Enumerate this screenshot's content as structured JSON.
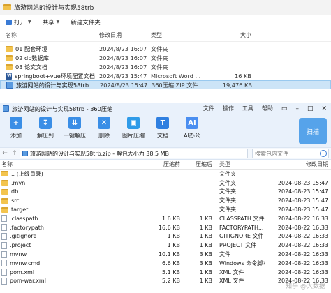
{
  "explorer": {
    "title": "旅游网站的设计与实现58trb",
    "toolbar": {
      "open": "打开",
      "share": "共享",
      "new_folder": "新建文件夹"
    },
    "header": {
      "name": "名称",
      "date": "修改日期",
      "type": "类型",
      "size": "大小"
    },
    "files": [
      {
        "name": "01 配套环境",
        "date": "2024/8/23 16:07",
        "type": "文件夹",
        "size": "",
        "icon": "folder-icon",
        "selected": false
      },
      {
        "name": "02 db数据库",
        "date": "2024/8/23 16:07",
        "type": "文件夹",
        "size": "",
        "icon": "folder-icon",
        "selected": false
      },
      {
        "name": "03 论文文档",
        "date": "2024/8/23 16:07",
        "type": "文件夹",
        "size": "",
        "icon": "folder-icon",
        "selected": false
      },
      {
        "name": "springboot+vue环境配置文档",
        "date": "2024/8/23 15:47",
        "type": "Microsoft Word ...",
        "size": "16 KB",
        "icon": "word-icon",
        "selected": false
      },
      {
        "name": "旅游网站的设计与实现58trb",
        "date": "2024/8/23 15:47",
        "type": "360压缩 ZIP 文件",
        "size": "19,476 KB",
        "icon": "zip-icon",
        "selected": true
      }
    ]
  },
  "zip_window": {
    "title": "旅游网站的设计与实现58trb - 360压缩",
    "menu": [
      "文件",
      "操作",
      "工具",
      "帮助"
    ],
    "toolbar": [
      {
        "label": "添加",
        "icon": "add-icon",
        "color": "#3a8ee6",
        "glyph": "+"
      },
      {
        "label": "解压到",
        "icon": "extract-to-icon",
        "color": "#3a8ee6",
        "glyph": "↧"
      },
      {
        "label": "一键解压",
        "icon": "one-click-extract-icon",
        "color": "#3a8ee6",
        "glyph": "⇊"
      },
      {
        "label": "删除",
        "icon": "delete-icon",
        "color": "#3a8ee6",
        "glyph": "✕"
      },
      {
        "label": "图片压缩",
        "icon": "image-compress-icon",
        "color": "#2f9be8",
        "glyph": "▣"
      },
      {
        "label": "文档",
        "icon": "document-icon",
        "color": "#2f7fe0",
        "glyph": "T"
      },
      {
        "label": "AI办公",
        "icon": "ai-office-icon",
        "color": "#4a8ef0",
        "glyph": "AI"
      }
    ],
    "scan_label": "扫描",
    "path": "旅游网站的设计与实现58trb.zip - 解包大小为 38.5 MB",
    "search_placeholder": "搜索包内文件",
    "header": {
      "name": "名称",
      "compressed": "压缩前",
      "original": "压缩后",
      "type": "类型",
      "date": "修改日期"
    },
    "rows": [
      {
        "name": ".. (上级目录)",
        "compressed": "",
        "original": "",
        "type": "文件夹",
        "date": "",
        "icon": "up-folder-icon"
      },
      {
        "name": ".mvn",
        "compressed": "",
        "original": "",
        "type": "文件夹",
        "date": "2024-08-23 15:47",
        "icon": "folder-icon"
      },
      {
        "name": "db",
        "compressed": "",
        "original": "",
        "type": "文件夹",
        "date": "2024-08-23 15:47",
        "icon": "folder-icon"
      },
      {
        "name": "src",
        "compressed": "",
        "original": "",
        "type": "文件夹",
        "date": "2024-08-23 15:47",
        "icon": "folder-icon"
      },
      {
        "name": "target",
        "compressed": "",
        "original": "",
        "type": "文件夹",
        "date": "2024-08-23 15:47",
        "icon": "folder-icon"
      },
      {
        "name": ".classpath",
        "compressed": "1.6 KB",
        "original": "1 KB",
        "type": "CLASSPATH 文件",
        "date": "2024-08-22 16:33",
        "icon": "file-icon"
      },
      {
        "name": ".factorypath",
        "compressed": "16.6 KB",
        "original": "1 KB",
        "type": "FACTORYPATH...",
        "date": "2024-08-22 16:33",
        "icon": "file-icon"
      },
      {
        "name": ".gitignore",
        "compressed": "1 KB",
        "original": "1 KB",
        "type": "GITIGNORE 文件",
        "date": "2024-08-22 16:33",
        "icon": "file-icon"
      },
      {
        "name": ".project",
        "compressed": "1 KB",
        "original": "1 KB",
        "type": "PROJECT 文件",
        "date": "2024-08-22 16:33",
        "icon": "file-icon"
      },
      {
        "name": "mvnw",
        "compressed": "10.1 KB",
        "original": "3 KB",
        "type": "文件",
        "date": "2024-08-22 16:33",
        "icon": "file-icon"
      },
      {
        "name": "mvnw.cmd",
        "compressed": "6.6 KB",
        "original": "3 KB",
        "type": "Windows 命令脚本",
        "date": "2024-08-22 16:33",
        "icon": "file-icon"
      },
      {
        "name": "pom.xml",
        "compressed": "5.1 KB",
        "original": "1 KB",
        "type": "XML 文件",
        "date": "2024-08-22 16:33",
        "icon": "file-icon"
      },
      {
        "name": "pom-war.xml",
        "compressed": "5.2 KB",
        "original": "1 KB",
        "type": "XML 文件",
        "date": "2024-08-22 16:33",
        "icon": "file-icon"
      }
    ],
    "watermark": "知乎 @大数据"
  }
}
